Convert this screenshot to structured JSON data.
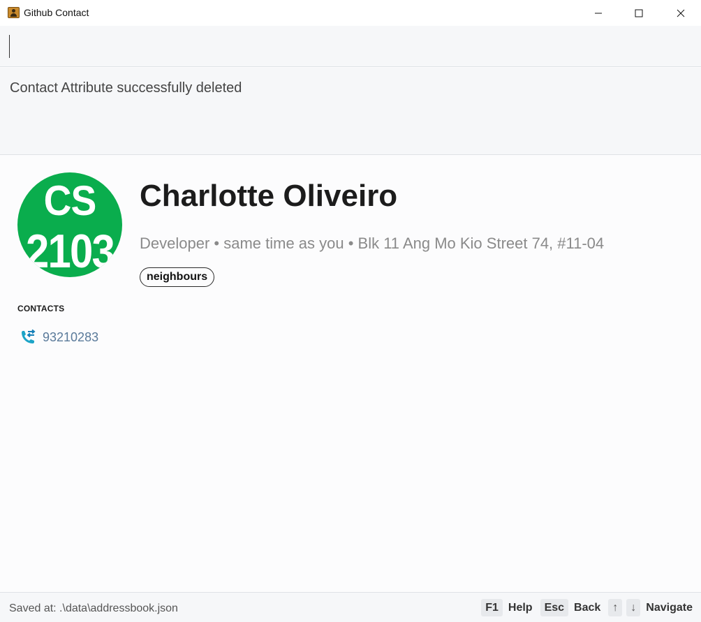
{
  "window": {
    "title": "Github Contact"
  },
  "command": {
    "value": "",
    "placeholder": ""
  },
  "result": {
    "message": "Contact Attribute successfully deleted"
  },
  "contact": {
    "avatar_line1": "CS",
    "avatar_line2": "2103",
    "name": "Charlotte Oliveiro",
    "meta": "Developer • same time as you • Blk 11 Ang Mo Kio Street 74, #11-04",
    "tags": [
      "neighbours"
    ],
    "contacts_heading": "CONTACTS",
    "phone": "93210283",
    "phone_icon": "phone-transfer-icon"
  },
  "statusbar": {
    "saved_path": "Saved at: .\\data\\addressbook.json",
    "shortcuts": {
      "help_key": "F1",
      "help_label": "Help",
      "back_key": "Esc",
      "back_label": "Back",
      "up_key": "↑",
      "down_key": "↓",
      "navigate_label": "Navigate"
    }
  },
  "colors": {
    "avatar_bg": "#0aad4d",
    "phone_icon": "#1ca4c7"
  }
}
